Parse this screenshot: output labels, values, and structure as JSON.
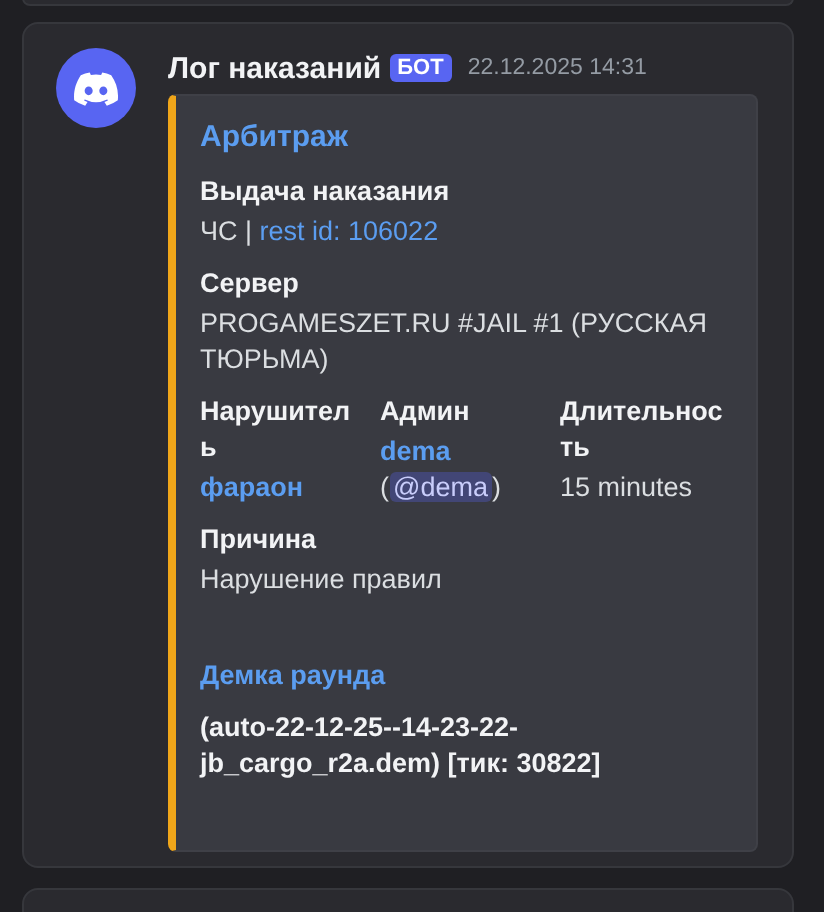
{
  "message": {
    "username": "Лог наказаний",
    "badge": "БОТ",
    "timestamp": "22.12.2025 14:31"
  },
  "embed": {
    "title": "Арбитраж",
    "fields": [
      {
        "kind": "block",
        "name": "Выдача наказания",
        "value": [
          {
            "kind": "text",
            "text": "ЧС | "
          },
          {
            "kind": "link",
            "text": "rest id: 106022"
          }
        ]
      },
      {
        "kind": "block",
        "name": "Сервер",
        "value": [
          {
            "kind": "text",
            "text": "PROGAMESZET.RU #JAIL #1 (РУССКАЯ ТЮРЬМА)"
          }
        ]
      },
      {
        "kind": "inline",
        "name": "Нарушитель",
        "value": [
          {
            "kind": "user",
            "text": "фараон"
          }
        ]
      },
      {
        "kind": "inline",
        "name": "Админ",
        "value": [
          {
            "kind": "user",
            "text": "dema"
          },
          {
            "kind": "break"
          },
          {
            "kind": "text",
            "text": "("
          },
          {
            "kind": "mention",
            "text": "@dema"
          },
          {
            "kind": "text",
            "text": ")"
          }
        ]
      },
      {
        "kind": "inline",
        "name": "Длительность",
        "value": [
          {
            "kind": "text",
            "text": "15 minutes"
          }
        ]
      },
      {
        "kind": "block",
        "name": "Причина",
        "value": [
          {
            "kind": "text",
            "text": "Нарушение правил"
          }
        ]
      },
      {
        "kind": "demo",
        "name": "Демка раунда",
        "value": [
          {
            "kind": "text",
            "text": "(auto-22-12-25--14-23-22-jb_cargo_r2a.dem) [тик: 30822]"
          }
        ]
      }
    ]
  }
}
